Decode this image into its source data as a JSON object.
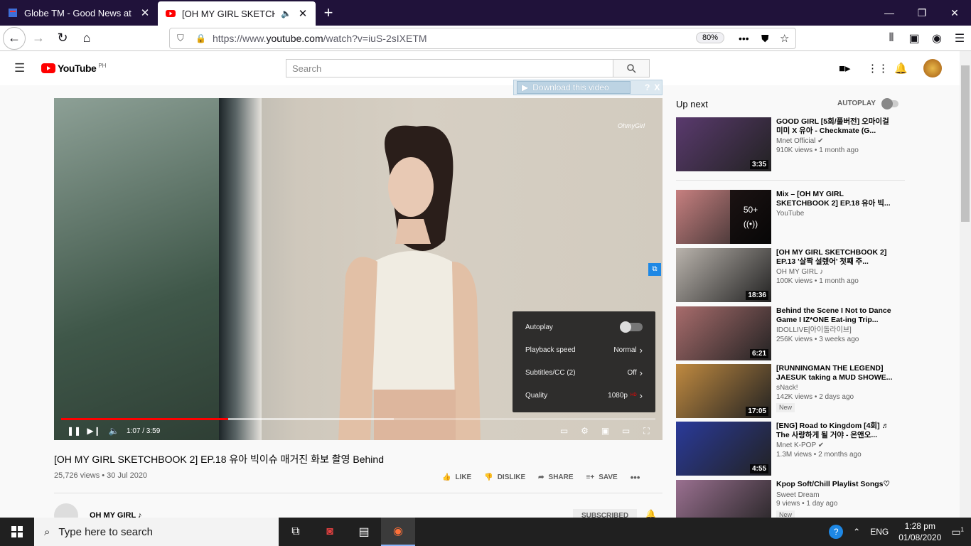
{
  "browser": {
    "tabs": [
      {
        "title": "Globe TM - Good News at Bad",
        "active": false
      },
      {
        "title": "[OH MY GIRL SKETCHBOOK",
        "active": true
      }
    ],
    "url_prefix": "https://www.",
    "url_domain": "youtube.com",
    "url_path": "/watch?v=iuS-2sIXETM",
    "zoom": "80%"
  },
  "youtube": {
    "logo_text": "YouTube",
    "region": "PH",
    "search_placeholder": "Search"
  },
  "download_bar": {
    "label": "Download this video",
    "help": "?",
    "close": "X"
  },
  "player": {
    "watermark": "OhmyGirl",
    "time": "1:07 / 3:59",
    "progress": 0.281,
    "buffered": 0.56,
    "settings": [
      {
        "label": "Autoplay",
        "value": ""
      },
      {
        "label": "Playback speed",
        "value": "Normal"
      },
      {
        "label": "Subtitles/CC (2)",
        "value": "Off"
      },
      {
        "label": "Quality",
        "value": "1080p"
      }
    ],
    "hd_badge": "HD"
  },
  "video": {
    "title": "[OH MY GIRL SKETCHBOOK 2] EP.18 유아 빅이슈 매거진 화보 촬영 Behind",
    "meta": "25,726 views • 30 Jul 2020",
    "actions": [
      "LIKE",
      "DISLIKE",
      "SHARE",
      "SAVE"
    ],
    "channel": "OH MY GIRL ♪",
    "subscribe_label": "SUBSCRIBED"
  },
  "sidebar": {
    "up_next": "Up next",
    "autoplay": "AUTOPLAY",
    "items": [
      {
        "title": "GOOD GIRL [5회/풀버전] 오마이걸 미미 X 유아 - Checkmate (G...",
        "channel": "Mnet Official ✔",
        "stats": "910K views • 1 month ago",
        "duration": "3:35",
        "badge": "",
        "thumb": "#5a3a6e"
      },
      {
        "title": "Mix – [OH MY GIRL SKETCHBOOK 2] EP.18 유아 빅...",
        "channel": "YouTube",
        "stats": "",
        "duration": "",
        "badge": "",
        "mix": "50+",
        "thumb": "#c78080"
      },
      {
        "title": "[OH MY GIRL SKETCHBOOK 2] EP.13 '살짝 설렜어' 첫째 주...",
        "channel": "OH MY GIRL ♪",
        "stats": "100K views • 1 month ago",
        "duration": "18:36",
        "badge": "",
        "thumb": "#b9b3ac"
      },
      {
        "title": "Behind the Scene I Not to Dance Game I IZ*ONE Eat-ing Trip...",
        "channel": "IDOLLIVE[아이돌라이브]",
        "stats": "256K views • 3 weeks ago",
        "duration": "6:21",
        "badge": "",
        "thumb": "#a86c6c"
      },
      {
        "title": "[RUNNINGMAN THE LEGEND] JAESUK taking a MUD SHOWE...",
        "channel": "sNack!",
        "stats": "142K views • 2 days ago",
        "duration": "17:05",
        "badge": "New",
        "thumb": "#c08a40"
      },
      {
        "title": "[ENG] Road to Kingdom [4회] ♬ The 사랑하게 될 거야 - 온앤오...",
        "channel": "Mnet K-POP ✔",
        "stats": "1.3M views • 2 months ago",
        "duration": "4:55",
        "badge": "",
        "thumb": "#2a3a9a"
      },
      {
        "title": "Kpop Soft/Chill Playlist Songs♡",
        "channel": "Sweet Dream",
        "stats": "9 views • 1 day ago",
        "duration": "",
        "badge": "New",
        "thumb": "#9a7090"
      }
    ]
  },
  "taskbar": {
    "search_placeholder": "Type here to search",
    "language": "ENG",
    "time": "1:28 pm",
    "date": "01/08/2020",
    "notification_count": "1"
  }
}
